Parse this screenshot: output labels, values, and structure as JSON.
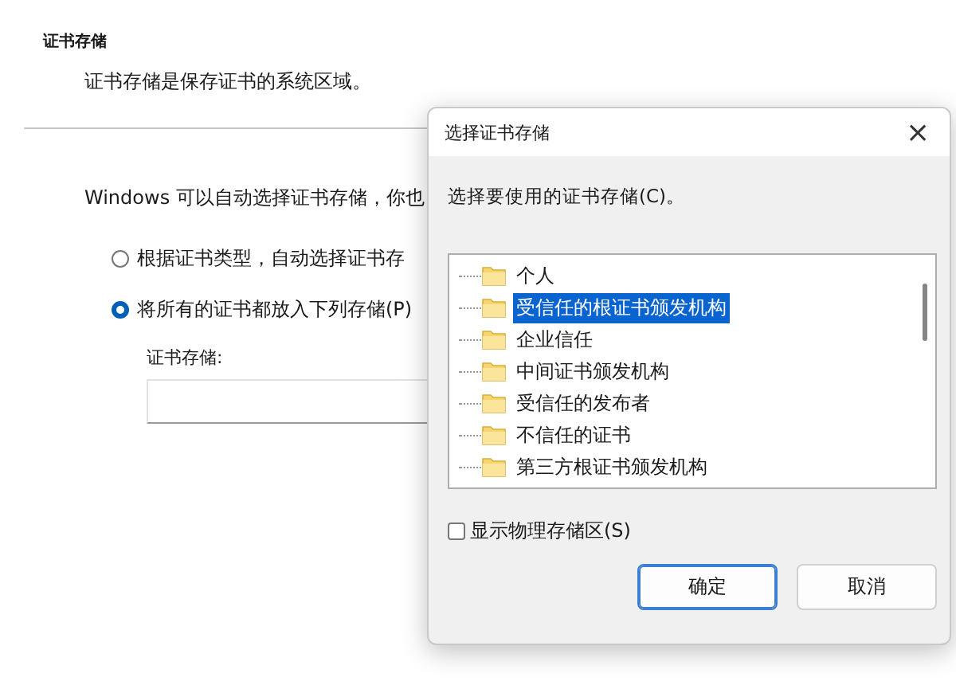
{
  "page": {
    "heading": "证书存储",
    "description": "证书存储是保存证书的系统区域。",
    "intro": "Windows 可以自动选择证书存储，你也",
    "options": [
      {
        "label": "根据证书类型，自动选择证书存",
        "selected": false
      },
      {
        "label": "将所有的证书都放入下列存储(P)",
        "selected": true
      }
    ],
    "store_label": "证书存储:"
  },
  "dialog": {
    "title": "选择证书存储",
    "close": "×",
    "instruction": "选择要使用的证书存储(C)。",
    "stores": [
      {
        "label": "个人",
        "selected": false
      },
      {
        "label": "受信任的根证书颁发机构",
        "selected": true
      },
      {
        "label": "企业信任",
        "selected": false
      },
      {
        "label": "中间证书颁发机构",
        "selected": false
      },
      {
        "label": "受信任的发布者",
        "selected": false
      },
      {
        "label": "不信任的证书",
        "selected": false
      },
      {
        "label": "第三方根证书颁发机构",
        "selected": false
      }
    ],
    "show_physical": {
      "label": "显示物理存储区(S)",
      "checked": false
    },
    "buttons": [
      {
        "label": "确定",
        "kind": "default"
      },
      {
        "label": "取消",
        "kind": "normal"
      }
    ]
  }
}
